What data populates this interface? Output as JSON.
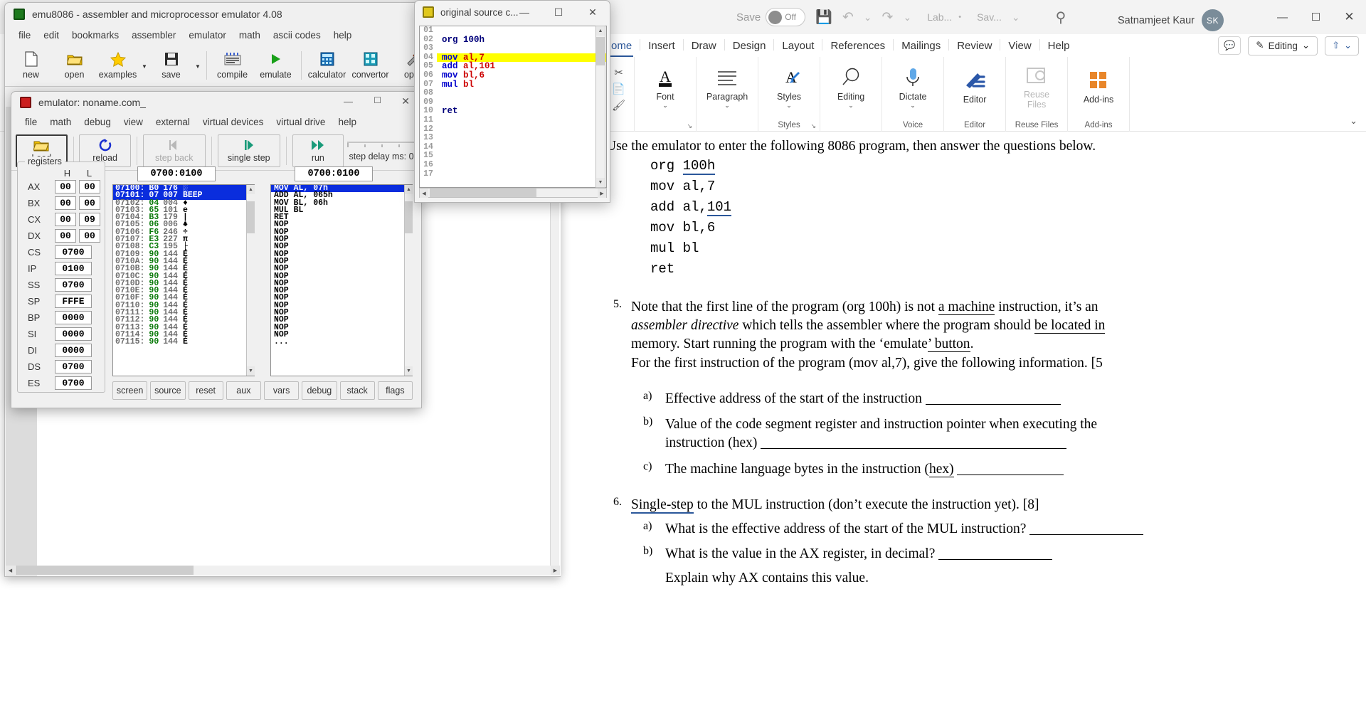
{
  "word": {
    "title_bar": {
      "autosave_label": "Save",
      "autosave_state": "Off",
      "save_icon": "floppy-disk-icon",
      "undo_icon": "undo-icon",
      "redo_icon": "redo-icon",
      "customize_icon": "chevron-down-icon",
      "file_name": "Lab...",
      "separator_dot": "•",
      "saved_state": "Sav...",
      "dropdown_icon": "chevron-down-icon",
      "search_icon": "search-icon",
      "user_name": "Satnamjeet Kaur",
      "avatar_initials": "SK",
      "minimize": "—",
      "maximize": "☐",
      "close": "✕"
    },
    "tabs": [
      {
        "label": "ome",
        "active": true
      },
      {
        "label": "Insert",
        "active": false
      },
      {
        "label": "Draw",
        "active": false
      },
      {
        "label": "Design",
        "active": false
      },
      {
        "label": "Layout",
        "active": false
      },
      {
        "label": "References",
        "active": false
      },
      {
        "label": "Mailings",
        "active": false
      },
      {
        "label": "Review",
        "active": false
      },
      {
        "label": "View",
        "active": false
      },
      {
        "label": "Help",
        "active": false
      }
    ],
    "tabs_right": {
      "comments_icon": "comment-icon",
      "editing_label": "Editing",
      "editing_icon": "pencil-icon",
      "editing_chevron": "⌄",
      "share_icon": "share-icon",
      "share_chevron": "⌄"
    },
    "ribbon": {
      "collapse_icon": "chevron-down-icon",
      "clipboard": {
        "cut_icon": "scissors-icon",
        "copy_icon": "copy-icon",
        "format_painter_icon": "paintbrush-icon"
      },
      "groups": [
        {
          "name": "",
          "dialog_launcher": "↘",
          "items": [
            {
              "label": "Font",
              "icon": "font-icon",
              "chevron": "⌄",
              "dim": false
            }
          ]
        },
        {
          "name": "",
          "dialog_launcher": "",
          "items": [
            {
              "label": "Paragraph",
              "icon": "paragraph-icon",
              "chevron": "⌄",
              "dim": false
            }
          ]
        },
        {
          "name": "Styles",
          "dialog_launcher": "↘",
          "items": [
            {
              "label": "Styles",
              "icon": "styles-icon",
              "chevron": "⌄",
              "dim": false
            }
          ]
        },
        {
          "name": "",
          "dialog_launcher": "",
          "items": [
            {
              "label": "Editing",
              "icon": "magnifier-icon",
              "chevron": "⌄",
              "dim": false
            }
          ]
        },
        {
          "name": "Voice",
          "dialog_launcher": "",
          "items": [
            {
              "label": "Dictate",
              "icon": "microphone-icon",
              "chevron": "⌄",
              "dim": false
            }
          ]
        },
        {
          "name": "Editor",
          "dialog_launcher": "",
          "items": [
            {
              "label": "Editor",
              "icon": "editor-pen-icon",
              "chevron": "",
              "dim": false
            }
          ]
        },
        {
          "name": "Reuse Files",
          "dialog_launcher": "",
          "items": [
            {
              "label": "Reuse Files",
              "icon": "reuse-files-icon",
              "chevron": "",
              "dim": true
            }
          ]
        },
        {
          "name": "Add-ins",
          "dialog_launcher": "",
          "items": [
            {
              "label": "Add-ins",
              "icon": "addins-grid-icon",
              "chevron": "",
              "dim": false
            }
          ]
        }
      ]
    },
    "document": {
      "intro": "Use the emulator to enter the following 8086 program, then answer the questions below.",
      "code": [
        {
          "text": "org ",
          "underlined": "100h",
          "spell_error": ""
        },
        {
          "text": "mov al,7",
          "underlined": "",
          "spell_error": ""
        },
        {
          "text": "add al,",
          "underlined": "101",
          "spell_error": ""
        },
        {
          "text": "mov bl,6",
          "underlined": "",
          "spell_error": ""
        },
        {
          "text": " bl",
          "underlined": "",
          "spell_error": "mul"
        },
        {
          "text": "ret",
          "underlined": "",
          "spell_error": ""
        }
      ],
      "q5": {
        "number": "5.",
        "line1_a": "Note that the first line of the program (org 100h) is not ",
        "line1_u": "a machine",
        "line1_b": " instruction, it’s an",
        "line2_i": "assembler directive",
        "line2_a": " which tells the assembler where the program should ",
        "line2_u": "be located in",
        "line3_a": "memory. Start running the program with the ‘emulate",
        "line3_u": "’ button",
        "line3_b": ".",
        "line4": "For the first instruction of the program (mov al,7), give the following information. [5",
        "items": [
          {
            "letter": "a)",
            "text": "Effective address of the start of the instruction",
            "blank": true
          },
          {
            "letter": "b)",
            "text": "Value of the code segment register and instruction pointer when executing the",
            "text2": "instruction (hex)",
            "blank": true
          },
          {
            "letter": "c)",
            "text": "The machine language bytes in the instruction (",
            "text_u": "hex)",
            "blank": true
          }
        ]
      },
      "q6": {
        "number": "6.",
        "lead_u": "Single-step",
        "lead": " to the MUL instruction (don’t execute the instruction yet). [8]",
        "items": [
          {
            "letter": "a)",
            "text": "What is the effective address of the start of the MUL instruction?",
            "blank": true
          },
          {
            "letter": "b)",
            "text": "What is the value in the AX register, in decimal?",
            "blank": true
          },
          {
            "letter": "",
            "text": "Explain why AX contains this value.",
            "blank": false
          }
        ]
      }
    }
  },
  "emu_main": {
    "title": "emu8086 - assembler and microprocessor emulator 4.08",
    "icon": "chip-icon",
    "menus": [
      "file",
      "edit",
      "bookmarks",
      "assembler",
      "emulator",
      "math",
      "ascii codes",
      "help"
    ],
    "toolbar": [
      {
        "label": "new",
        "icon": "new-file-icon",
        "arrow": false
      },
      {
        "label": "open",
        "icon": "open-folder-icon",
        "arrow": false
      },
      {
        "label": "examples",
        "icon": "star-icon",
        "arrow": true
      },
      {
        "label": "save",
        "icon": "floppy-disk-icon",
        "arrow": true
      },
      {
        "label": "compile",
        "icon": "compile-icon",
        "arrow": false
      },
      {
        "label": "emulate",
        "icon": "play-icon",
        "arrow": false
      },
      {
        "label": "calculator",
        "icon": "calculator-icon",
        "arrow": false
      },
      {
        "label": "convertor",
        "icon": "convertor-icon",
        "arrow": false
      },
      {
        "label": "optio",
        "icon": "tools-icon",
        "arrow": false
      }
    ],
    "editor_lines": [
      {
        "num": "01",
        "text": ""
      },
      {
        "num": "02",
        "text": "org 100h"
      },
      {
        "num": "03",
        "text": ""
      }
    ]
  },
  "emulator": {
    "title": "emulator: noname.com_",
    "icon": "chip-icon",
    "minimize": "—",
    "maximize": "☐",
    "close": "✕",
    "menus": [
      "file",
      "math",
      "debug",
      "view",
      "external",
      "virtual devices",
      "virtual drive",
      "help"
    ],
    "buttons": [
      {
        "label": "Load",
        "icon": "open-folder-icon",
        "active": true,
        "dim": false
      },
      {
        "label": "reload",
        "icon": "reload-icon",
        "active": false,
        "dim": false
      },
      {
        "label": "step back",
        "icon": "step-back-icon",
        "active": false,
        "dim": true
      },
      {
        "label": "single step",
        "icon": "single-step-icon",
        "active": false,
        "dim": false
      },
      {
        "label": "run",
        "icon": "run-icon",
        "active": false,
        "dim": false
      }
    ],
    "delay": {
      "label": "step delay ms: 0",
      "icon": "slider-icon"
    },
    "registers": {
      "legend": "registers",
      "col_h": "H",
      "col_l": "L",
      "pairs": [
        {
          "name": "AX",
          "h": "00",
          "l": "00"
        },
        {
          "name": "BX",
          "h": "00",
          "l": "00"
        },
        {
          "name": "CX",
          "h": "00",
          "l": "09"
        },
        {
          "name": "DX",
          "h": "00",
          "l": "00"
        }
      ],
      "singles": [
        {
          "name": "CS",
          "value": "0700"
        },
        {
          "name": "IP",
          "value": "0100"
        },
        {
          "name": "SS",
          "value": "0700"
        },
        {
          "name": "SP",
          "value": "FFFE"
        },
        {
          "name": "BP",
          "value": "0000"
        },
        {
          "name": "SI",
          "value": "0000"
        },
        {
          "name": "DI",
          "value": "0000"
        },
        {
          "name": "DS",
          "value": "0700"
        },
        {
          "name": "ES",
          "value": "0700"
        }
      ]
    },
    "memory": {
      "address": "0700:0100",
      "rows": [
        {
          "addr": "07100:",
          "hex": "B0",
          "dec": "176",
          "chr": "░",
          "sel": true
        },
        {
          "addr": "07101:",
          "hex": "07",
          "dec": "007",
          "chr": "BEEP",
          "sel": true
        },
        {
          "addr": "07102:",
          "hex": "04",
          "dec": "004",
          "chr": "♦",
          "sel": false
        },
        {
          "addr": "07103:",
          "hex": "65",
          "dec": "101",
          "chr": "e",
          "sel": false
        },
        {
          "addr": "07104:",
          "hex": "B3",
          "dec": "179",
          "chr": "|",
          "sel": false
        },
        {
          "addr": "07105:",
          "hex": "06",
          "dec": "006",
          "chr": "♣",
          "sel": false
        },
        {
          "addr": "07106:",
          "hex": "F6",
          "dec": "246",
          "chr": "÷",
          "sel": false
        },
        {
          "addr": "07107:",
          "hex": "E3",
          "dec": "227",
          "chr": "π",
          "sel": false
        },
        {
          "addr": "07108:",
          "hex": "C3",
          "dec": "195",
          "chr": "├",
          "sel": false
        },
        {
          "addr": "07109:",
          "hex": "90",
          "dec": "144",
          "chr": "É",
          "sel": false
        },
        {
          "addr": "0710A:",
          "hex": "90",
          "dec": "144",
          "chr": "É",
          "sel": false
        },
        {
          "addr": "0710B:",
          "hex": "90",
          "dec": "144",
          "chr": "É",
          "sel": false
        },
        {
          "addr": "0710C:",
          "hex": "90",
          "dec": "144",
          "chr": "É",
          "sel": false
        },
        {
          "addr": "0710D:",
          "hex": "90",
          "dec": "144",
          "chr": "É",
          "sel": false
        },
        {
          "addr": "0710E:",
          "hex": "90",
          "dec": "144",
          "chr": "É",
          "sel": false
        },
        {
          "addr": "0710F:",
          "hex": "90",
          "dec": "144",
          "chr": "É",
          "sel": false
        },
        {
          "addr": "07110:",
          "hex": "90",
          "dec": "144",
          "chr": "É",
          "sel": false
        },
        {
          "addr": "07111:",
          "hex": "90",
          "dec": "144",
          "chr": "É",
          "sel": false
        },
        {
          "addr": "07112:",
          "hex": "90",
          "dec": "144",
          "chr": "É",
          "sel": false
        },
        {
          "addr": "07113:",
          "hex": "90",
          "dec": "144",
          "chr": "É",
          "sel": false
        },
        {
          "addr": "07114:",
          "hex": "90",
          "dec": "144",
          "chr": "É",
          "sel": false
        },
        {
          "addr": "07115:",
          "hex": "90",
          "dec": "144",
          "chr": "É",
          "sel": false
        }
      ]
    },
    "disassembly": {
      "address": "0700:0100",
      "rows": [
        {
          "text": "MOV AL, 07h",
          "sel": true
        },
        {
          "text": "ADD AL, 065h",
          "sel": false
        },
        {
          "text": "MOV BL, 06h",
          "sel": false
        },
        {
          "text": "MUL BL",
          "sel": false
        },
        {
          "text": "RET",
          "sel": false
        },
        {
          "text": "NOP",
          "sel": false
        },
        {
          "text": "NOP",
          "sel": false
        },
        {
          "text": "NOP",
          "sel": false
        },
        {
          "text": "NOP",
          "sel": false
        },
        {
          "text": "NOP",
          "sel": false
        },
        {
          "text": "NOP",
          "sel": false
        },
        {
          "text": "NOP",
          "sel": false
        },
        {
          "text": "NOP",
          "sel": false
        },
        {
          "text": "NOP",
          "sel": false
        },
        {
          "text": "NOP",
          "sel": false
        },
        {
          "text": "NOP",
          "sel": false
        },
        {
          "text": "NOP",
          "sel": false
        },
        {
          "text": "NOP",
          "sel": false
        },
        {
          "text": "NOP",
          "sel": false
        },
        {
          "text": "NOP",
          "sel": false
        },
        {
          "text": "NOP",
          "sel": false
        },
        {
          "text": "...",
          "sel": false
        }
      ]
    },
    "bottom_buttons": [
      "screen",
      "source",
      "reset",
      "aux",
      "vars",
      "debug",
      "stack",
      "flags"
    ]
  },
  "source_window": {
    "title": "original source c...",
    "icon": "chip-icon",
    "minimize": "—",
    "maximize": "☐",
    "close": "✕",
    "lines": [
      {
        "num": "01",
        "kw": "",
        "op": "",
        "hl": false
      },
      {
        "num": "02",
        "kw": "org",
        "op": " 100h",
        "hl": false,
        "kwdark": true
      },
      {
        "num": "03",
        "kw": "",
        "op": "",
        "hl": false
      },
      {
        "num": "04",
        "kw": "mov",
        "op": " al,7",
        "hl": true
      },
      {
        "num": "05",
        "kw": "add",
        "op": " al,101",
        "hl": false
      },
      {
        "num": "06",
        "kw": "mov",
        "op": " bl,6",
        "hl": false
      },
      {
        "num": "07",
        "kw": "mul",
        "op": " bl",
        "hl": false
      },
      {
        "num": "08",
        "kw": "",
        "op": "",
        "hl": false
      },
      {
        "num": "09",
        "kw": "",
        "op": "",
        "hl": false
      },
      {
        "num": "10",
        "kw": "ret",
        "op": "",
        "hl": false,
        "kwdark": true
      },
      {
        "num": "11",
        "kw": "",
        "op": "",
        "hl": false
      },
      {
        "num": "12",
        "kw": "",
        "op": "",
        "hl": false
      },
      {
        "num": "13",
        "kw": "",
        "op": "",
        "hl": false
      },
      {
        "num": "14",
        "kw": "",
        "op": "",
        "hl": false
      },
      {
        "num": "15",
        "kw": "",
        "op": "",
        "hl": false
      },
      {
        "num": "16",
        "kw": "",
        "op": "",
        "hl": false
      },
      {
        "num": "17",
        "kw": "",
        "op": "",
        "hl": false
      }
    ]
  },
  "colors": {
    "word_accent": "#2b579a",
    "highlight_yellow": "#ffff00",
    "selection_blue": "#0a2ddd",
    "hex_green": "#0a7a0a",
    "keyword_blue": "#0000cc",
    "operand_red": "#cc0000"
  }
}
